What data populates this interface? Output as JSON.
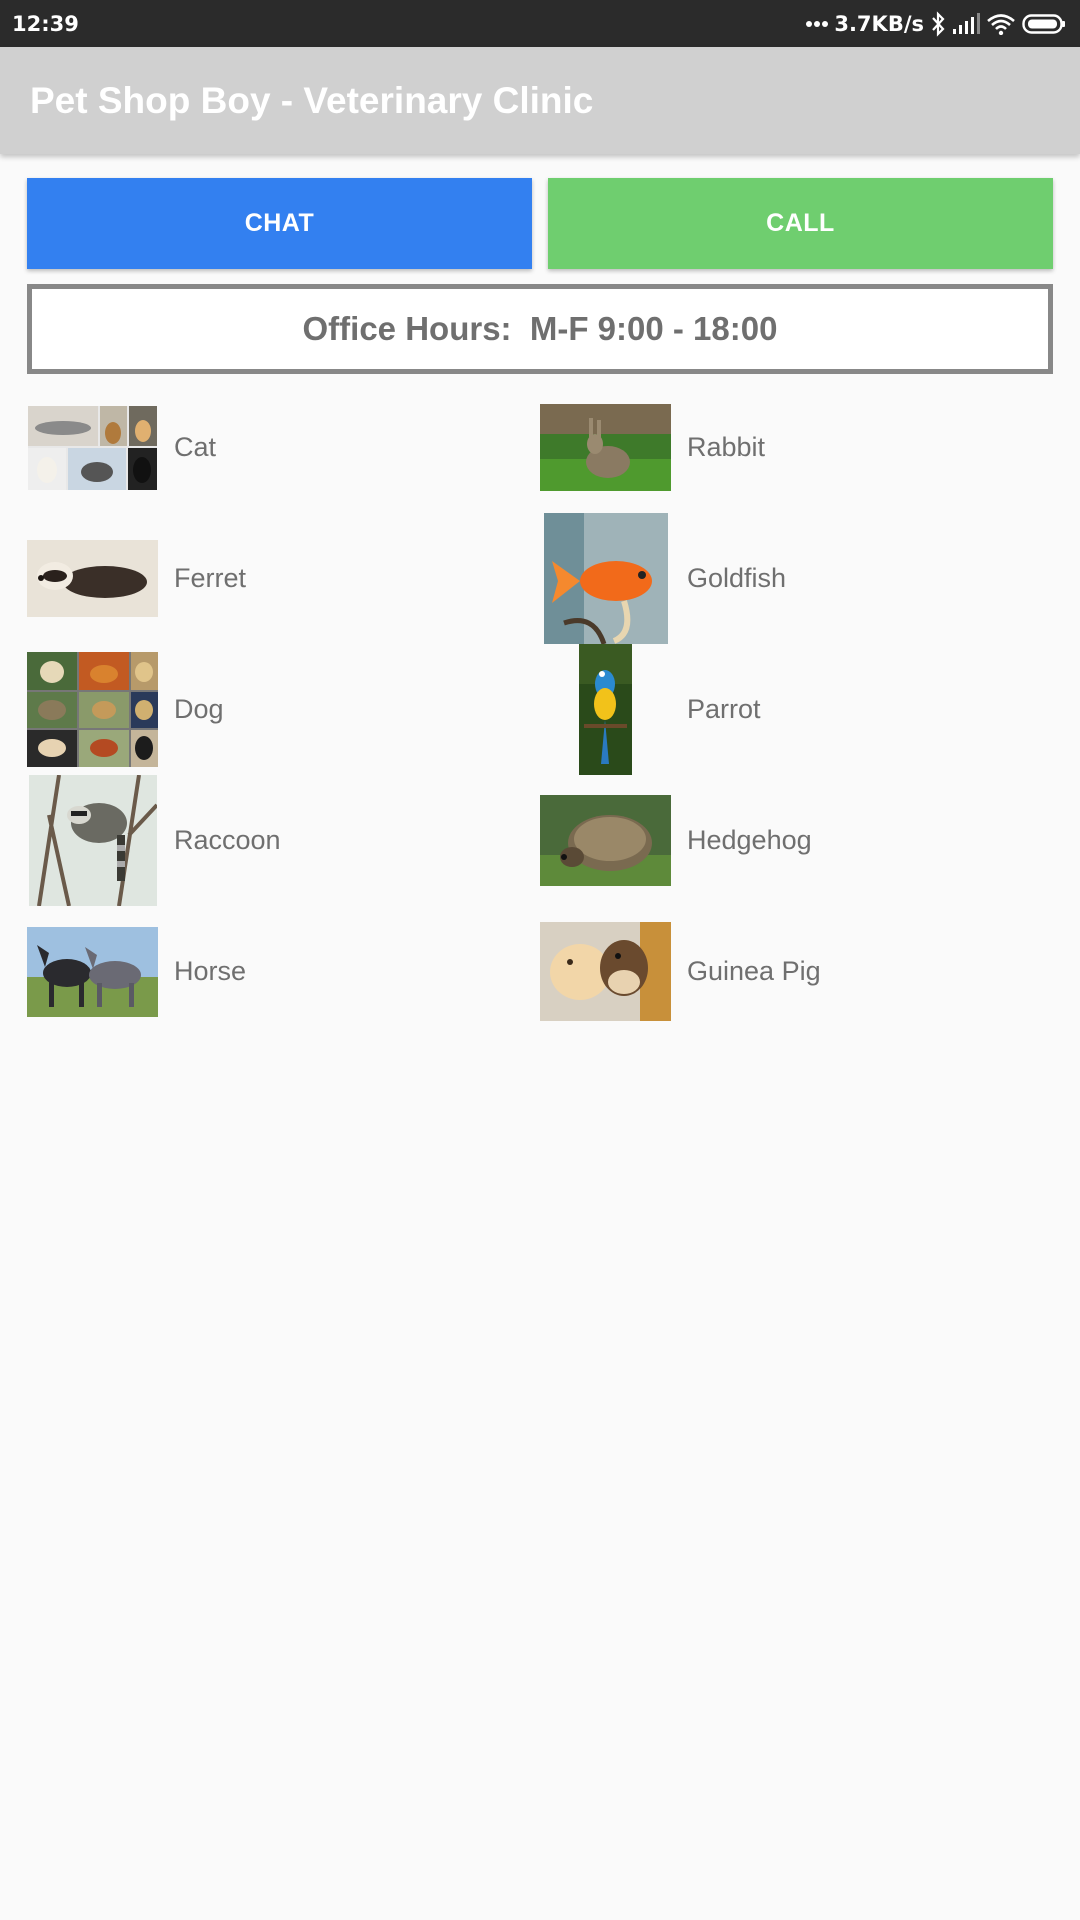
{
  "status_bar": {
    "time": "12:39",
    "network_speed": "3.7KB/s",
    "icons": [
      "dots-icon",
      "bluetooth-icon",
      "signal-icon",
      "wifi-icon",
      "battery-icon"
    ]
  },
  "app_bar": {
    "title": "Pet Shop Boy - Veterinary Clinic"
  },
  "actions": {
    "chat_label": "CHAT",
    "call_label": "CALL"
  },
  "office_hours": {
    "text": "Office Hours:  M-F 9:00 - 18:00"
  },
  "animals": [
    {
      "label": "Cat",
      "icon": "cat-photo"
    },
    {
      "label": "Rabbit",
      "icon": "rabbit-photo"
    },
    {
      "label": "Ferret",
      "icon": "ferret-photo"
    },
    {
      "label": "Goldfish",
      "icon": "goldfish-photo"
    },
    {
      "label": "Dog",
      "icon": "dog-photo"
    },
    {
      "label": "Parrot",
      "icon": "parrot-photo"
    },
    {
      "label": "Raccoon",
      "icon": "raccoon-photo"
    },
    {
      "label": "Hedgehog",
      "icon": "hedgehog-photo"
    },
    {
      "label": "Horse",
      "icon": "horse-photo"
    },
    {
      "label": "Guinea Pig",
      "icon": "guinea-pig-photo"
    }
  ],
  "colors": {
    "status_bar": "#2b2b2b",
    "app_bar": "#d0d0d0",
    "chat_button": "#3380f0",
    "call_button": "#6fce6f",
    "text_gray": "#6f6f6f",
    "border_gray": "#888888"
  }
}
